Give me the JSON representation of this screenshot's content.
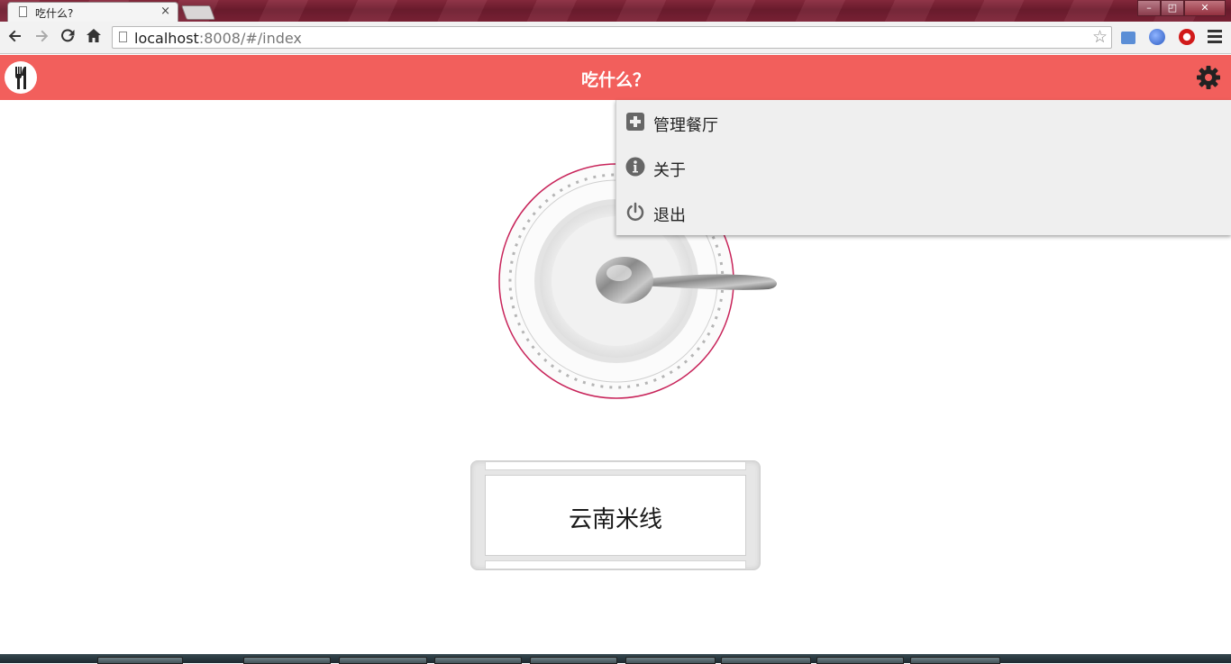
{
  "browser": {
    "tab_title": "吃什么?",
    "tab_close": "×",
    "url_host": "localhost",
    "url_path": ":8008/#/index",
    "window_buttons": {
      "minimize": "–",
      "restore": "◰",
      "close": "✕"
    }
  },
  "app": {
    "title": "吃什么？",
    "accent_color": "#f25f5c",
    "logo_icon": "fork-knife-icon",
    "settings_icon": "gear-icon"
  },
  "menu": {
    "items": [
      {
        "label": "管理餐厅",
        "icon": "plus-square-icon"
      },
      {
        "label": "关于",
        "icon": "info-circle-icon"
      },
      {
        "label": "退出",
        "icon": "power-icon"
      }
    ]
  },
  "main": {
    "plate_image": "plate-with-spoon",
    "result": "云南米线"
  }
}
